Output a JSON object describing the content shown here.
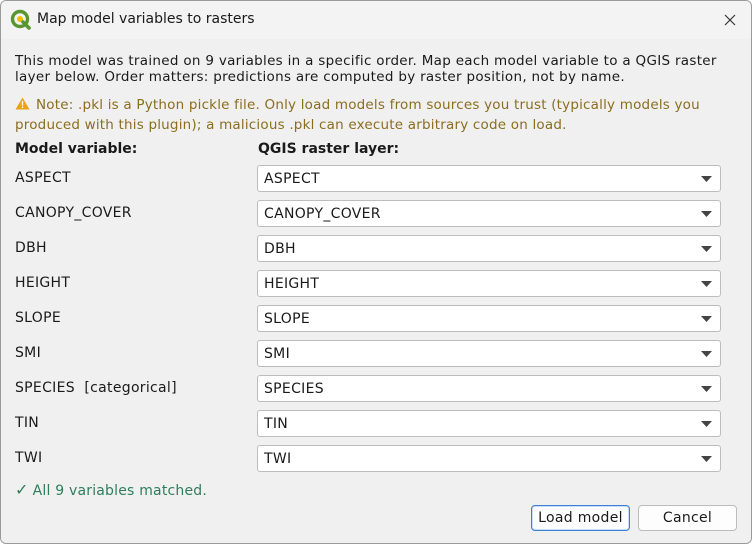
{
  "window": {
    "title": "Map model variables to rasters",
    "app_icon": "qgis-logo-icon",
    "close_icon": "close-icon"
  },
  "description": "This model was trained on 9 variables in a specific order. Map each model variable to a QGIS raster layer below. Order matters: predictions are computed by raster position, not by name.",
  "warning": {
    "icon": "warning-icon",
    "text": "Note: .pkl is a Python pickle file. Only load models from sources you trust (typically models you produced with this plugin); a malicious .pkl can execute arbitrary code on load."
  },
  "columns": {
    "model_variable": "Model variable:",
    "raster_layer": "QGIS raster layer:"
  },
  "rows": [
    {
      "variable": "ASPECT",
      "layer": "ASPECT"
    },
    {
      "variable": "CANOPY_COVER",
      "layer": "CANOPY_COVER"
    },
    {
      "variable": "DBH",
      "layer": "DBH"
    },
    {
      "variable": "HEIGHT",
      "layer": "HEIGHT"
    },
    {
      "variable": "SLOPE",
      "layer": "SLOPE"
    },
    {
      "variable": "SMI",
      "layer": "SMI"
    },
    {
      "variable": "SPECIES  [categorical]",
      "layer": "SPECIES"
    },
    {
      "variable": "TIN",
      "layer": "TIN"
    },
    {
      "variable": "TWI",
      "layer": "TWI"
    }
  ],
  "status": {
    "icon": "checkmark-icon",
    "text": "All 9 variables matched."
  },
  "buttons": {
    "load": "Load model",
    "cancel": "Cancel"
  },
  "colors": {
    "warning_text": "#8a6d1f",
    "status_text": "#2e7d5b",
    "primary_border": "#3d7fd6"
  }
}
